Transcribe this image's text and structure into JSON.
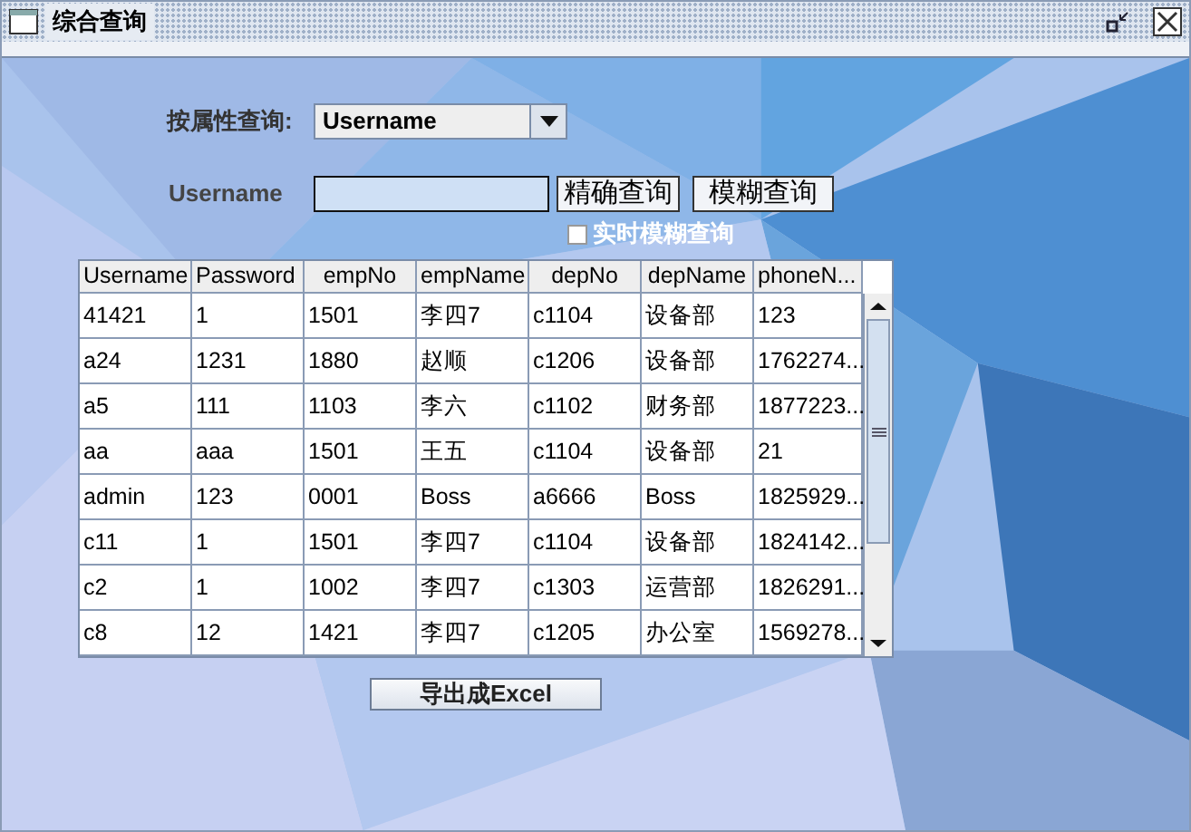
{
  "window": {
    "title": "综合查询"
  },
  "query": {
    "attribute_label": "按属性查询:",
    "attribute_value": "Username",
    "field_label": "Username",
    "buttons": [
      "精确查询",
      "模糊查询"
    ],
    "realtime": {
      "label": "实时模糊查询",
      "checked": false
    }
  },
  "table": {
    "columns": [
      "Username",
      "Password",
      "empNo",
      "empName",
      "depNo",
      "depName",
      "phoneN..."
    ],
    "rows": [
      [
        "41421",
        "1",
        "1501",
        "李四7",
        "c1104",
        "设备部",
        "123"
      ],
      [
        "a24",
        "1231",
        "1880",
        "赵顺",
        "c1206",
        "设备部",
        "1762274..."
      ],
      [
        "a5",
        "111",
        "1103",
        "李六",
        "c1102",
        "财务部",
        "1877223..."
      ],
      [
        "aa",
        "aaa",
        "1501",
        "王五",
        "c1104",
        "设备部",
        "21"
      ],
      [
        "admin",
        "123",
        "0001",
        "Boss",
        "a6666",
        "Boss",
        "1825929..."
      ],
      [
        "c11",
        "1",
        "1501",
        "李四7",
        "c1104",
        "设备部",
        "1824142..."
      ],
      [
        "c2",
        "1",
        "1002",
        "李四7",
        "c1303",
        "运营部",
        "1826291..."
      ],
      [
        "c8",
        "12",
        "1421",
        "李四7",
        "c1205",
        "办公室",
        "1569278..."
      ]
    ]
  },
  "export_button": "导出成Excel"
}
